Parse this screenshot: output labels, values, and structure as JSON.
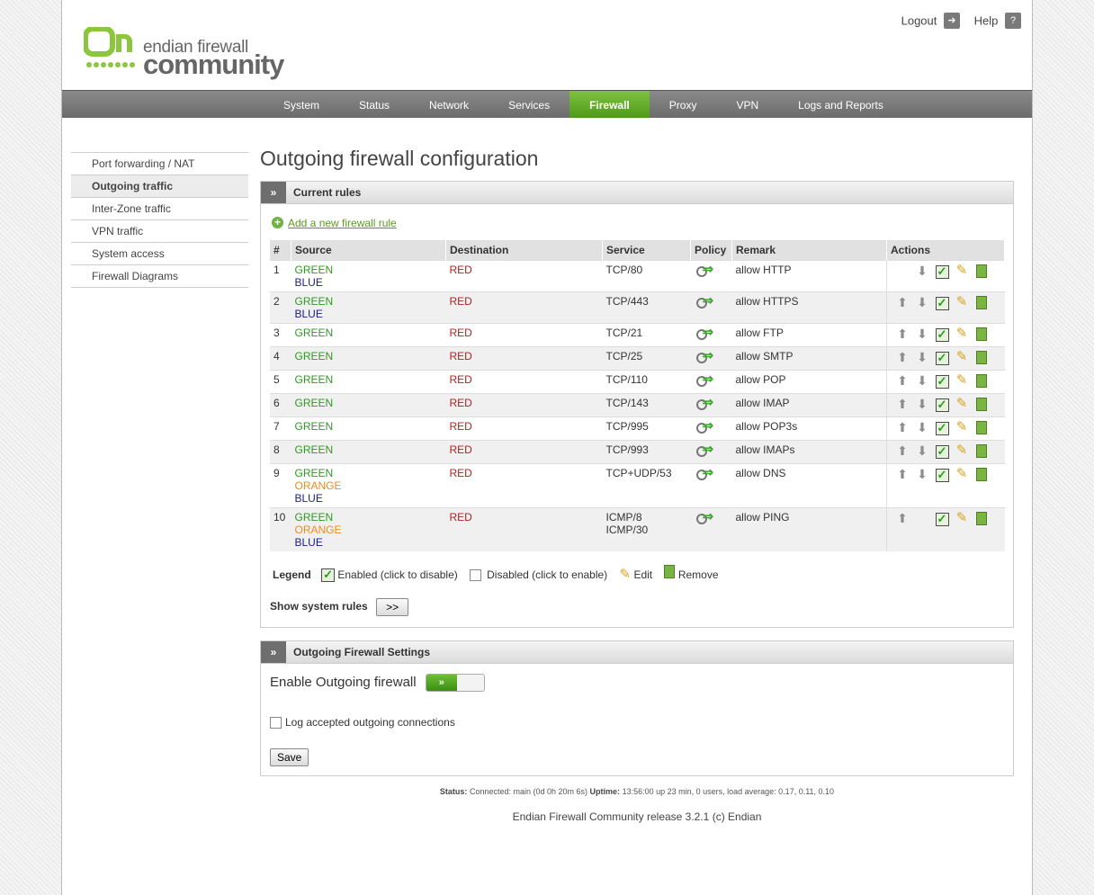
{
  "brand": {
    "line1": "endian firewall",
    "line2": "community"
  },
  "toplinks": [
    {
      "label": "Logout",
      "icon": "logout-icon"
    },
    {
      "label": "Help",
      "icon": "help-icon"
    }
  ],
  "nav": [
    "System",
    "Status",
    "Network",
    "Services",
    "Firewall",
    "Proxy",
    "VPN",
    "Logs and Reports"
  ],
  "nav_active": "Firewall",
  "sidebar": [
    "Port forwarding / NAT",
    "Outgoing traffic",
    "Inter-Zone traffic",
    "VPN traffic",
    "System access",
    "Firewall Diagrams"
  ],
  "sidebar_active": "Outgoing traffic",
  "page_title": "Outgoing firewall configuration",
  "rules_box": {
    "title": "Current rules",
    "add_link": "Add a new firewall rule",
    "columns": [
      "#",
      "Source",
      "Destination",
      "Service",
      "Policy",
      "Remark",
      "Actions"
    ],
    "rules": [
      {
        "num": "1",
        "source": [
          "GREEN",
          "BLUE"
        ],
        "dest": "RED",
        "service": [
          "TCP/80"
        ],
        "remark": "allow HTTP",
        "up": false,
        "down": true
      },
      {
        "num": "2",
        "source": [
          "GREEN",
          "BLUE"
        ],
        "dest": "RED",
        "service": [
          "TCP/443"
        ],
        "remark": "allow HTTPS",
        "up": true,
        "down": true
      },
      {
        "num": "3",
        "source": [
          "GREEN"
        ],
        "dest": "RED",
        "service": [
          "TCP/21"
        ],
        "remark": "allow FTP",
        "up": true,
        "down": true
      },
      {
        "num": "4",
        "source": [
          "GREEN"
        ],
        "dest": "RED",
        "service": [
          "TCP/25"
        ],
        "remark": "allow SMTP",
        "up": true,
        "down": true
      },
      {
        "num": "5",
        "source": [
          "GREEN"
        ],
        "dest": "RED",
        "service": [
          "TCP/110"
        ],
        "remark": "allow POP",
        "up": true,
        "down": true
      },
      {
        "num": "6",
        "source": [
          "GREEN"
        ],
        "dest": "RED",
        "service": [
          "TCP/143"
        ],
        "remark": "allow IMAP",
        "up": true,
        "down": true
      },
      {
        "num": "7",
        "source": [
          "GREEN"
        ],
        "dest": "RED",
        "service": [
          "TCP/995"
        ],
        "remark": "allow POP3s",
        "up": true,
        "down": true
      },
      {
        "num": "8",
        "source": [
          "GREEN"
        ],
        "dest": "RED",
        "service": [
          "TCP/993"
        ],
        "remark": "allow IMAPs",
        "up": true,
        "down": true
      },
      {
        "num": "9",
        "source": [
          "GREEN",
          "ORANGE",
          "BLUE"
        ],
        "dest": "RED",
        "service": [
          "TCP+UDP/53"
        ],
        "remark": "allow DNS",
        "up": true,
        "down": true
      },
      {
        "num": "10",
        "source": [
          "GREEN",
          "ORANGE",
          "BLUE"
        ],
        "dest": "RED",
        "service": [
          "ICMP/8",
          "ICMP/30"
        ],
        "remark": "allow PING",
        "up": true,
        "down": false
      }
    ],
    "legend": {
      "label": "Legend",
      "enabled": "Enabled (click to disable)",
      "disabled": "Disabled (click to enable)",
      "edit": "Edit",
      "remove": "Remove"
    },
    "show_system_rules": "Show system rules",
    "show_button": ">>"
  },
  "settings_box": {
    "title": "Outgoing Firewall Settings",
    "enable_label": "Enable Outgoing firewall",
    "toggle_label": "»",
    "log_label": "Log accepted outgoing connections",
    "save": "Save"
  },
  "status": {
    "status_label": "Status:",
    "status_value": "Connected: main (0d 0h 20m 6s)",
    "uptime_label": "Uptime:",
    "uptime_value": "13:56:00 up 23 min, 0 users, load average: 0.17, 0.11, 0.10"
  },
  "release": "Endian Firewall Community release 3.2.1 (c) Endian",
  "colors": {
    "green": "#2c9a22",
    "orange": "#f08b1f",
    "blue": "#1c1c8c",
    "red": "#b22222",
    "accent": "#5a9a1f"
  }
}
